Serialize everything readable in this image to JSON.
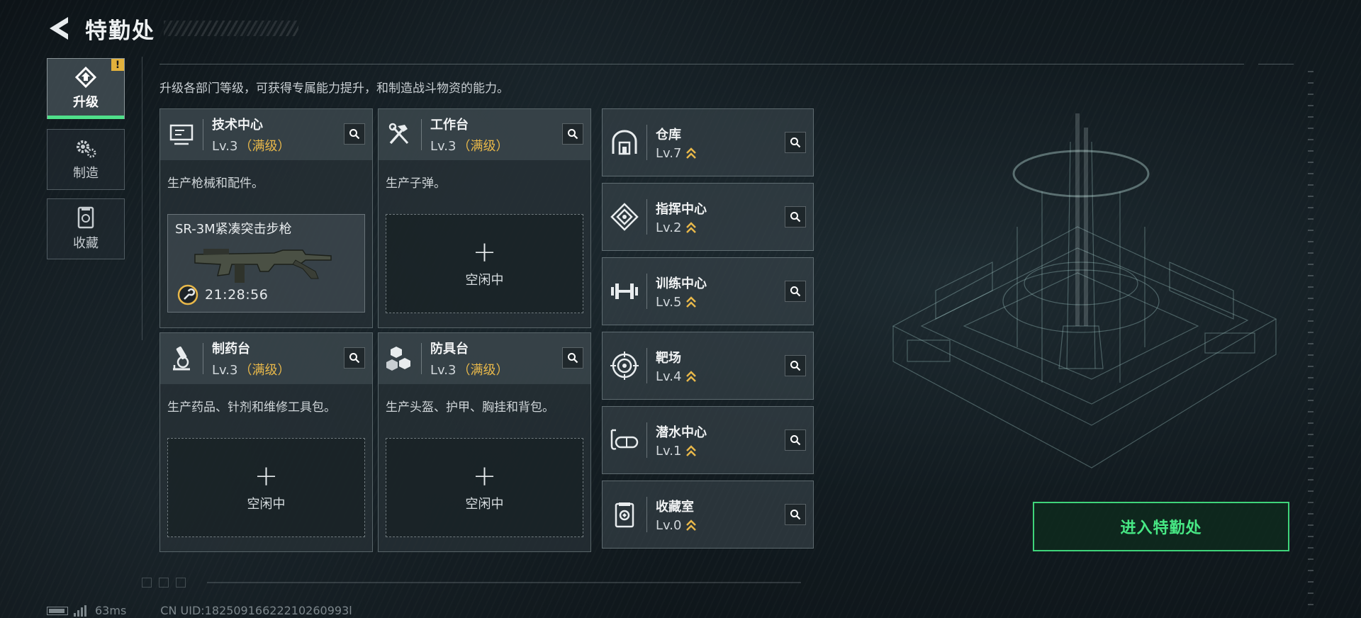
{
  "header": {
    "title": "特勤处"
  },
  "sidebar": {
    "tabs": [
      {
        "label": "升级",
        "icon": "upgrade-icon",
        "active": true,
        "badge": "!"
      },
      {
        "label": "制造",
        "icon": "gears-icon",
        "active": false
      },
      {
        "label": "收藏",
        "icon": "collection-icon",
        "active": false
      }
    ]
  },
  "description": "升级各部门等级，可获得专属能力提升，和制造战斗物资的能力。",
  "production": [
    {
      "name": "技术中心",
      "level": "Lv.3",
      "max": "（满级）",
      "desc": "生产枪械和配件。",
      "slot": {
        "busy": true,
        "item": "SR-3M紧凑突击步枪",
        "timer": "21:28:56"
      }
    },
    {
      "name": "工作台",
      "level": "Lv.3",
      "max": "（满级）",
      "desc": "生产子弹。",
      "slot": {
        "busy": false,
        "plus": "+",
        "label": "空闲中"
      }
    },
    {
      "name": "制药台",
      "level": "Lv.3",
      "max": "（满级）",
      "desc": "生产药品、针剂和维修工具包。",
      "slot": {
        "busy": false,
        "plus": "+",
        "label": "空闲中"
      }
    },
    {
      "name": "防具台",
      "level": "Lv.3",
      "max": "（满级）",
      "desc": "生产头盔、护甲、胸挂和背包。",
      "slot": {
        "busy": false,
        "plus": "+",
        "label": "空闲中"
      }
    }
  ],
  "facilities": [
    {
      "name": "仓库",
      "level": "Lv.7",
      "icon": "warehouse-icon"
    },
    {
      "name": "指挥中心",
      "level": "Lv.2",
      "icon": "command-icon"
    },
    {
      "name": "训练中心",
      "level": "Lv.5",
      "icon": "dumbbell-icon"
    },
    {
      "name": "靶场",
      "level": "Lv.4",
      "icon": "target-icon"
    },
    {
      "name": "潜水中心",
      "level": "Lv.1",
      "icon": "diving-mask-icon"
    },
    {
      "name": "收藏室",
      "level": "Lv.0",
      "icon": "collection-room-icon"
    }
  ],
  "enter_button": "进入特勤处",
  "status": {
    "ping": "63ms",
    "uid": "CN UID:18250916622210260993l"
  },
  "colors": {
    "accent_green": "#47e884",
    "max_gold": "#e8b84a",
    "badge_yellow": "#e2b13c"
  }
}
